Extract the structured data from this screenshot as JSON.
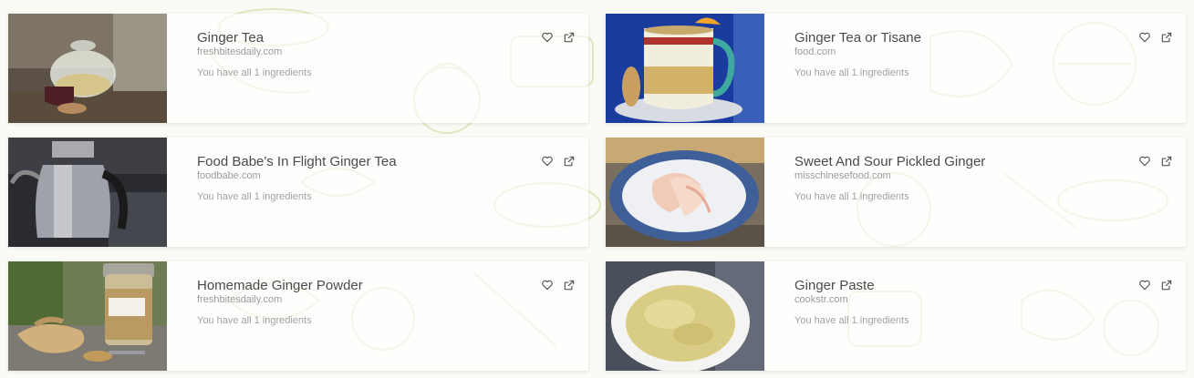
{
  "colors": {
    "background": "#fbfbf6",
    "doodle_stroke": "#dfe7c2",
    "title_text": "#4a4a4a",
    "meta_text": "#9a9a9a",
    "icon": "#555555"
  },
  "icons": {
    "favorite": "heart-icon",
    "open": "external-link-icon"
  },
  "recipes": [
    {
      "title": "Ginger Tea",
      "source": "freshbitesdaily.com",
      "ingredients": "You have all 1 ingredients",
      "photo": "teapot-photo"
    },
    {
      "title": "Ginger Tea or Tisane",
      "source": "food.com",
      "ingredients": "You have all 1 ingredients",
      "photo": "tea-mug-photo"
    },
    {
      "title": "Food Babe's In Flight Ginger Tea",
      "source": "foodbabe.com",
      "ingredients": "You have all 1 ingredients",
      "photo": "kettle-photo"
    },
    {
      "title": "Sweet And Sour Pickled Ginger",
      "source": "misschinesefood.com",
      "ingredients": "You have all 1 ingredients",
      "photo": "pickled-ginger-photo"
    },
    {
      "title": "Homemade Ginger Powder",
      "source": "freshbitesdaily.com",
      "ingredients": "You have all 1 ingredients",
      "photo": "ginger-jar-photo"
    },
    {
      "title": "Ginger Paste",
      "source": "cookstr.com",
      "ingredients": "You have all 1 ingredients",
      "photo": "ginger-paste-photo"
    }
  ]
}
